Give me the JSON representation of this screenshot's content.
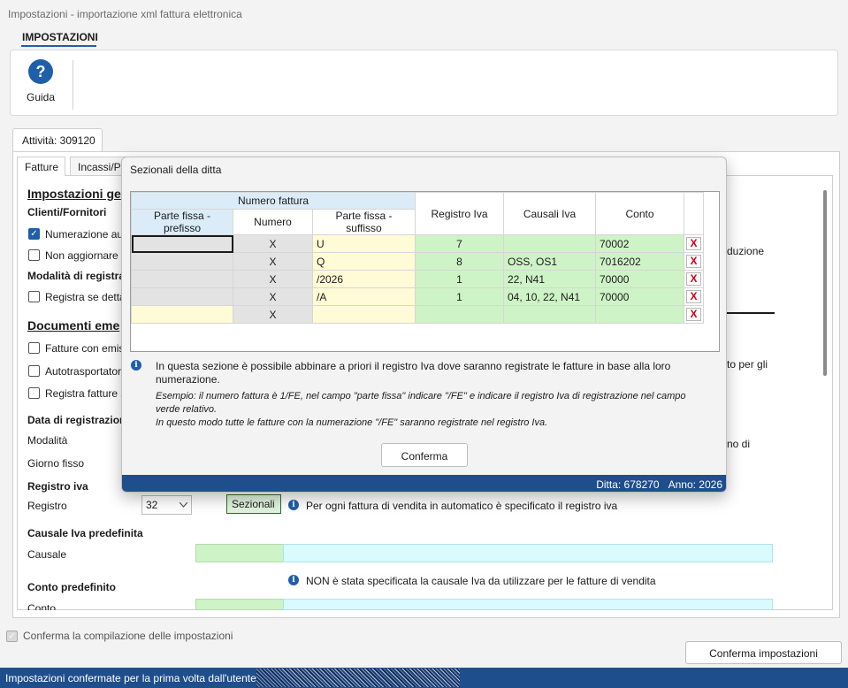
{
  "window": {
    "title": "Impostazioni - importazione xml fattura elettronica"
  },
  "ribbon": {
    "tab": "IMPOSTAZIONI",
    "guide_label": "Guida",
    "guide_glyph": "?"
  },
  "outer_tab": {
    "label": "Attività: 309120"
  },
  "inner_tabs": [
    {
      "label": "Fatture"
    },
    {
      "label": "Incassi/Pa"
    }
  ],
  "main": {
    "section1_title": "Impostazioni ge",
    "clienti_title": "Clienti/Fornitori",
    "cb_numerazione": "Numerazione au",
    "cb_non_aggiornare": "Non aggiornare",
    "modalita_title": "Modalità di registra",
    "cb_registra": "Registra se detta",
    "section2_title": "Documenti eme",
    "cb_fatture_emis": "Fatture con emis",
    "cb_autotrasportator": "Autotrasportator",
    "cb_registra_fatture": "Registra fatture s",
    "data_reg_title": "Data di registrazion",
    "modalita_label": "Modalità",
    "giorno_fisso_label": "Giorno fisso",
    "right_trunc_1": "duzione",
    "right_trunc_2": "to per gli",
    "right_trunc_3": "no di",
    "registro_iva_title": "Registro iva",
    "registro_label": "Registro",
    "registro_value": "32",
    "sezionali_button": "Sezionali",
    "registro_info": "Per ogni fattura di vendita in automatico è specificato il registro iva",
    "causale_title": "Causale Iva predefinita",
    "causale_label": "Causale",
    "causale_info": "NON è stata specificata la causale Iva da utilizzare per le fatture di vendita",
    "conto_title": "Conto predefinito",
    "conto_label": "Conto"
  },
  "footer": {
    "confirm_checkbox": "Conferma la compilazione delle impostazioni",
    "confirm_button": "Conferma impostazioni",
    "status": "Impostazioni confermate per la prima volta dall'utente"
  },
  "dialog": {
    "title": "Sezionali della ditta",
    "group_header": "Numero fattura",
    "columns": {
      "prefisso": "Parte fissa - prefisso",
      "numero": "Numero",
      "suffisso": "Parte fissa - suffisso",
      "registro": "Registro Iva",
      "causali": "Causali Iva",
      "conto": "Conto"
    },
    "rows": [
      {
        "prefisso": "",
        "numero": "X",
        "suffisso": "U",
        "registro": "7",
        "causali": "",
        "conto": "70002",
        "del": "X"
      },
      {
        "prefisso": "",
        "numero": "X",
        "suffisso": "Q",
        "registro": "8",
        "causali": "OSS, OS1",
        "conto": "7016202",
        "del": "X"
      },
      {
        "prefisso": "",
        "numero": "X",
        "suffisso": "/2026",
        "registro": "1",
        "causali": "22, N41",
        "conto": "70000",
        "del": "X"
      },
      {
        "prefisso": "",
        "numero": "X",
        "suffisso": "/A",
        "registro": "1",
        "causali": "04, 10, 22, N41",
        "conto": "70000",
        "del": "X"
      },
      {
        "prefisso": "",
        "numero": "X",
        "suffisso": "",
        "registro": "",
        "causali": "",
        "conto": "",
        "del": "X"
      }
    ],
    "info_text": "In questa sezione è possibile abbinare a priori il registro Iva dove saranno registrate le fatture in base alla loro numerazione.",
    "example_text_1": "Esempio: il numero fattura è 1/FE, nel campo \"parte fissa\" indicare \"/FE\" e indicare il registro Iva di registrazione nel campo verde relativo.",
    "example_text_2": "In questo modo tutte le fatture con la numerazione \"/FE\" saranno registrate nel registro Iva.",
    "confirm_button": "Conferma",
    "footer_ditta": "Ditta: 678270",
    "footer_anno": "Anno: 2026"
  },
  "colors": {
    "accent": "#1f5fa8",
    "status_bar": "#1f4e8c",
    "green_field": "#cef3c6",
    "yellow_field": "#fffbd6",
    "cyan_field": "#d9fbff",
    "delete_red": "#d0021b"
  },
  "icons": {
    "guide": "help-circle-icon",
    "info": "info-icon",
    "delete": "delete-x-icon",
    "dropdown": "chevron-down-icon"
  }
}
